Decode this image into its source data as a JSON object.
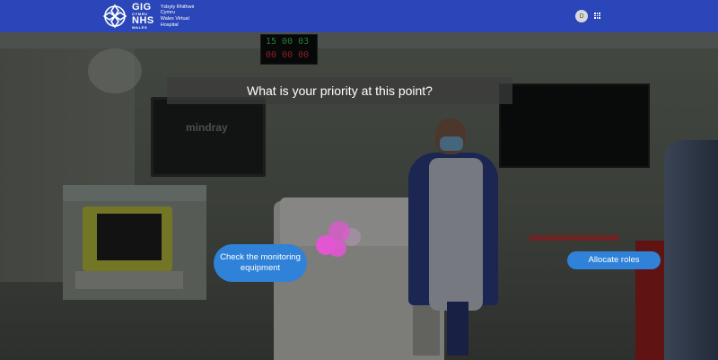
{
  "header": {
    "logo": {
      "abbr_top": "GIG",
      "abbr_small": "CYMRU",
      "abbr_mid": "NHS",
      "abbr_bottom": "WALES",
      "name_lines": [
        "Ysbyty Rhithwir",
        "Cymru",
        "Wales Virtual",
        "Hospital"
      ]
    },
    "avatar_initial": "D",
    "apps_icon": "apps-grid-icon"
  },
  "scene": {
    "monitor_brand": "mindray",
    "clock_line1": "15 00 03",
    "clock_line2": "00 00 00"
  },
  "question": {
    "text": "What is your priority at this point?"
  },
  "options": [
    {
      "label": "Check the monitoring equipment"
    },
    {
      "label": "Allocate roles"
    }
  ],
  "colors": {
    "header_bg": "#2a46b8",
    "button_bg": "#2f82d8",
    "hotspot": "#e257d1"
  }
}
